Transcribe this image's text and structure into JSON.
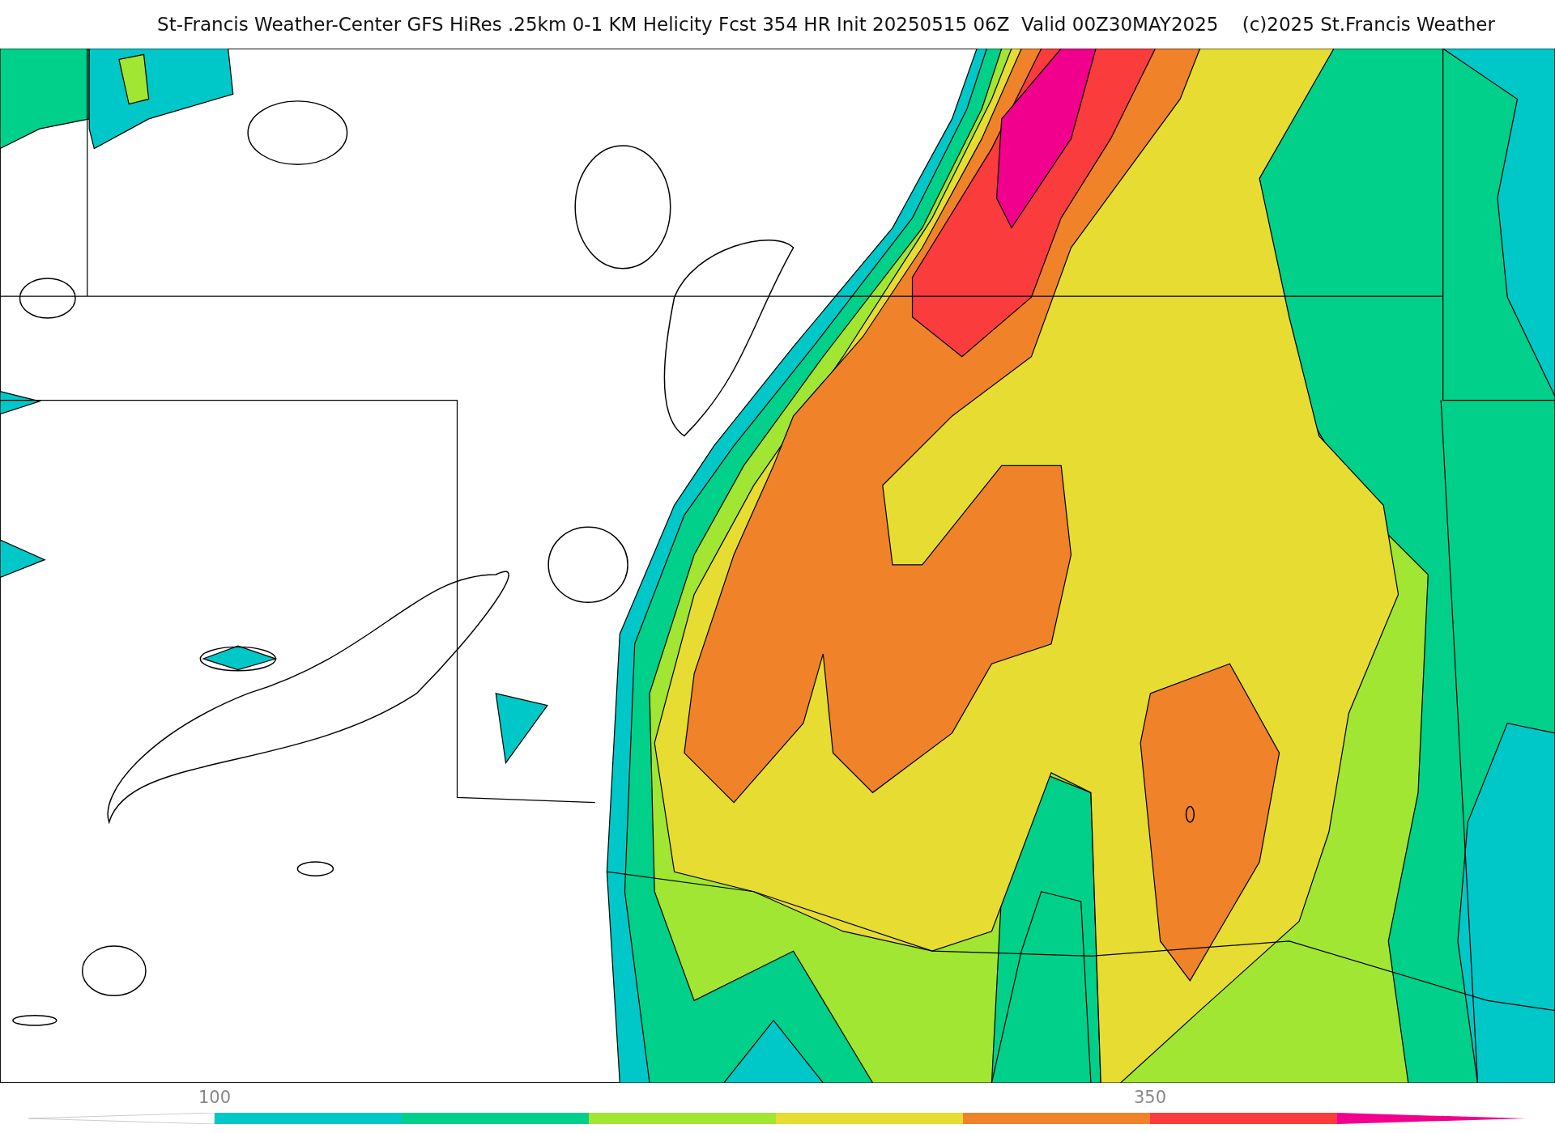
{
  "title": "St-Francis Weather-Center GFS HiRes .25km 0-1 KM Helicity Fcst 354 HR Init 20250515 06Z  Valid 00Z30MAY2025    (c)2025 St.Francis Weather",
  "colorbar": {
    "segments": [
      {
        "kind": "low-end",
        "color": "#ffffff"
      },
      {
        "kind": "bin",
        "color": "#00c8c8",
        "label": "100"
      },
      {
        "kind": "bin",
        "color": "#00d08a"
      },
      {
        "kind": "bin",
        "color": "#a0e632"
      },
      {
        "kind": "bin",
        "color": "#e6dc32"
      },
      {
        "kind": "bin",
        "color": "#f0822a"
      },
      {
        "kind": "bin",
        "color": "#fa3c3c",
        "label": "350"
      },
      {
        "kind": "high-end",
        "color": "#f0008c"
      }
    ]
  }
}
